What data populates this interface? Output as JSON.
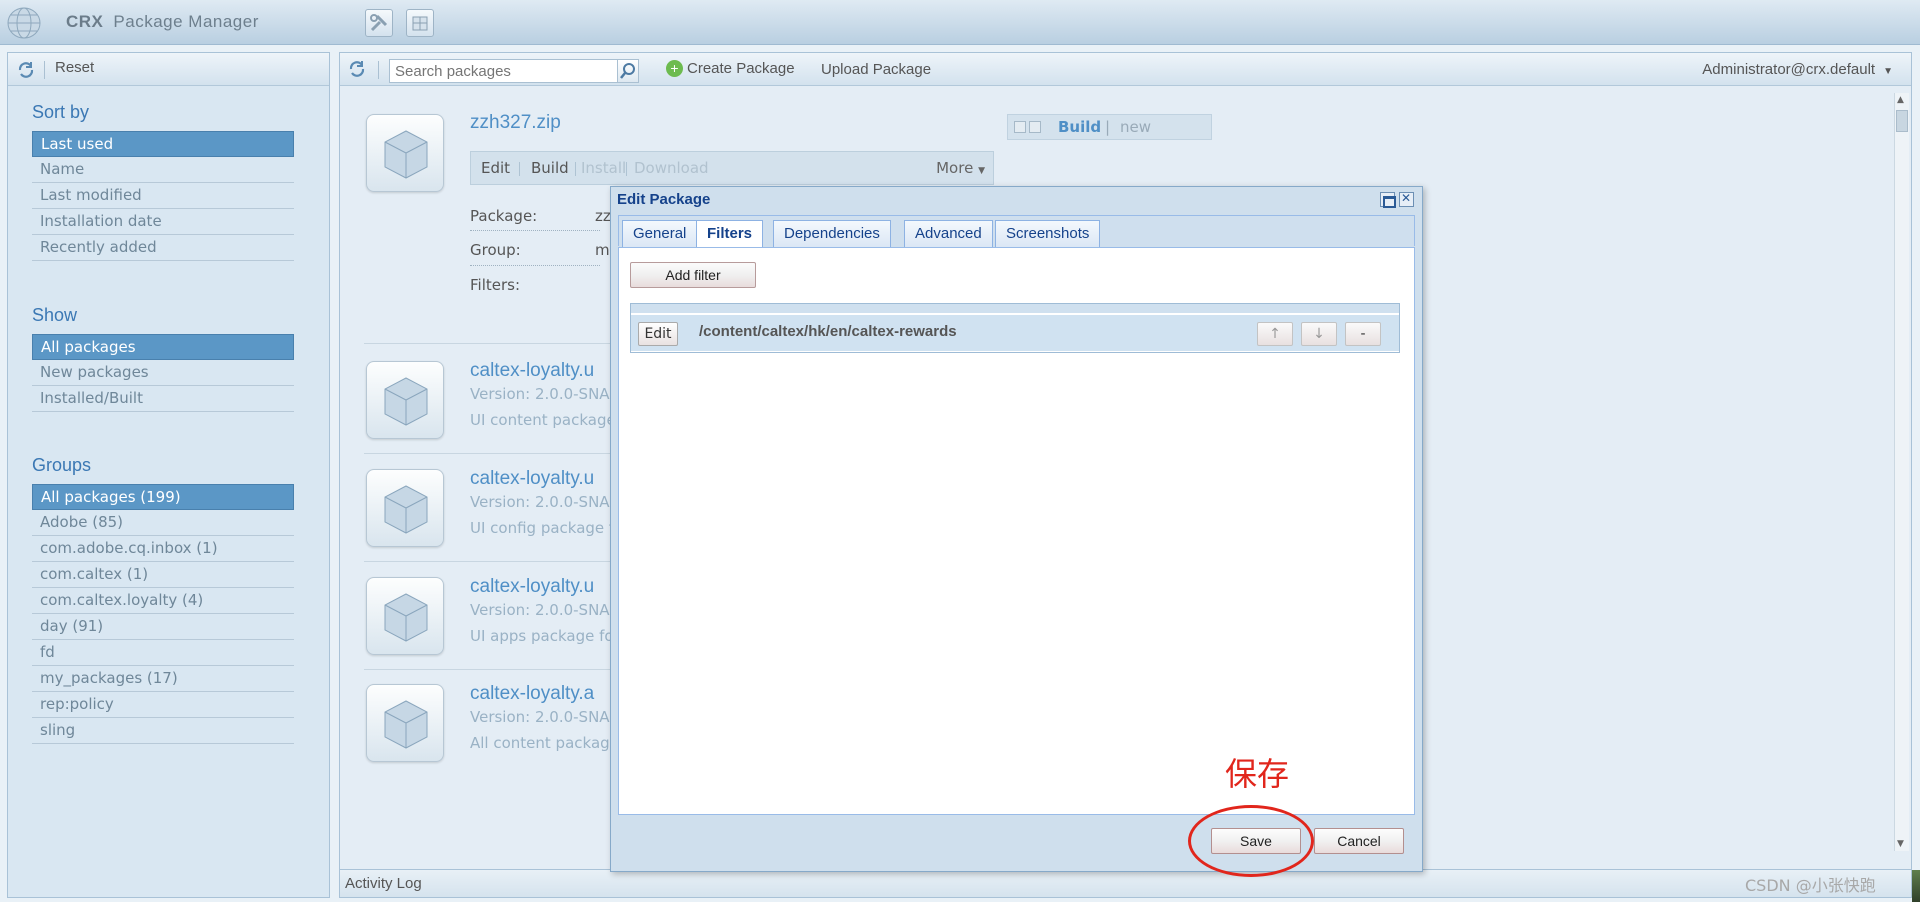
{
  "app": {
    "brand": "CRX",
    "title": "Package Manager",
    "tools_icon": "tools-icon",
    "packages_icon": "package-icon"
  },
  "sidebar": {
    "reset_label": "Reset",
    "sort_heading": "Sort by",
    "sort_items": [
      "Last used",
      "Name",
      "Last modified",
      "Installation date",
      "Recently added"
    ],
    "sort_selected": "Last used",
    "show_heading": "Show",
    "show_items": [
      "All packages",
      "New packages",
      "Installed/Built"
    ],
    "show_selected": "All packages",
    "groups_heading": "Groups",
    "groups_items": [
      "All packages (199)",
      "Adobe (85)",
      "com.adobe.cq.inbox (1)",
      "com.caltex (1)",
      "com.caltex.loyalty (4)",
      "day (91)",
      "fd",
      "my_packages (17)",
      "rep:policy",
      "sling"
    ],
    "groups_selected": "All packages (199)"
  },
  "toolbar": {
    "search_placeholder": "Search packages",
    "create_label": "Create Package",
    "upload_label": "Upload Package",
    "user_label": "Administrator@crx.default"
  },
  "selected_package": {
    "title": "zzh327.zip",
    "actions": {
      "edit": "Edit",
      "build": "Build",
      "install": "Install",
      "download": "Download",
      "more": "More"
    },
    "meta": {
      "package_label": "Package:",
      "package_value": "zz",
      "group_label": "Group:",
      "group_value": "m",
      "filters_label": "Filters:"
    },
    "build_link": "Build",
    "build_sep": "|",
    "status": "new"
  },
  "packages": [
    {
      "title": "caltex-loyalty.u",
      "version": "Version: 2.0.0-SNA",
      "desc": "UI content package"
    },
    {
      "title": "caltex-loyalty.u",
      "version": "Version: 2.0.0-SNA",
      "desc": "UI config package f"
    },
    {
      "title": "caltex-loyalty.u",
      "version": "Version: 2.0.0-SNA",
      "desc": "UI apps package fo"
    },
    {
      "title": "caltex-loyalty.a",
      "version": "Version: 2.0.0-SNA",
      "desc": "All content package"
    }
  ],
  "activity_log": "Activity Log",
  "dialog": {
    "title": "Edit Package",
    "tabs": [
      "General",
      "Filters",
      "Dependencies",
      "Advanced",
      "Screenshots"
    ],
    "active_tab": "Filters",
    "add_filter_label": "Add filter",
    "filters": [
      {
        "edit_label": "Edit",
        "path": "/content/caltex/hk/en/caltex-rewards"
      }
    ],
    "move_up": "↑",
    "move_down": "↓",
    "remove": "-",
    "save_label": "Save",
    "cancel_label": "Cancel"
  },
  "annotation": {
    "text": "保存",
    "color": "#e1261c"
  },
  "watermark": "CSDN @小张快跑"
}
